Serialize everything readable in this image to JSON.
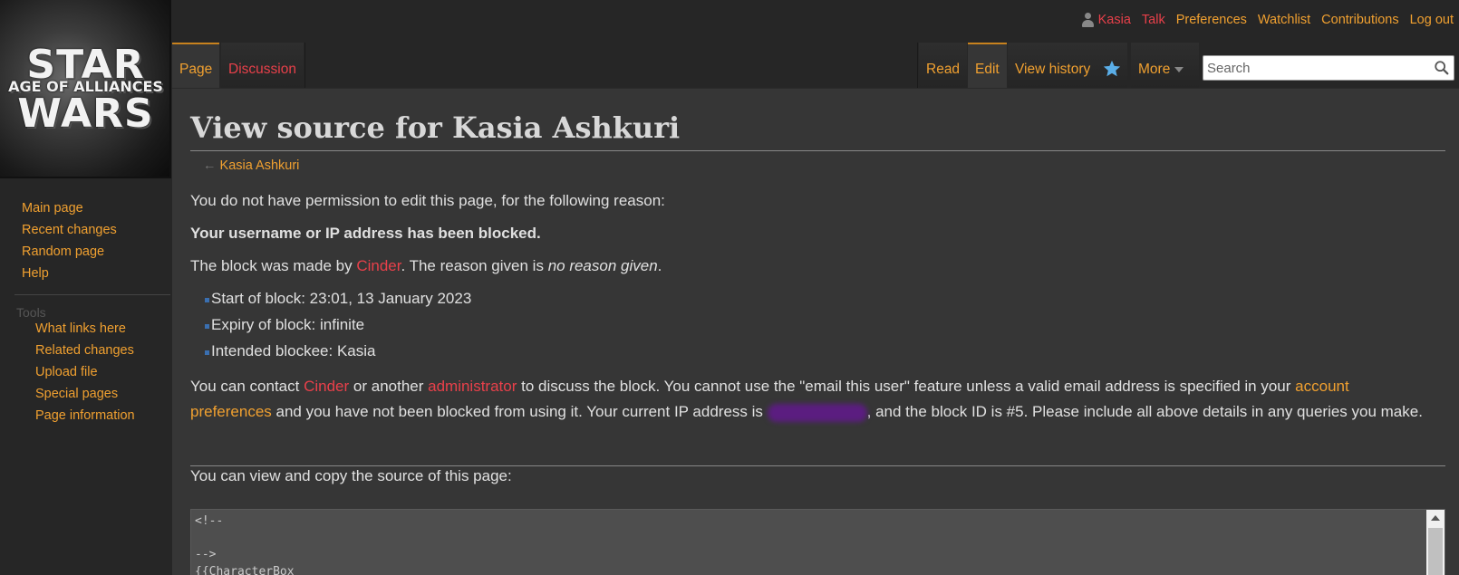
{
  "logo": {
    "line1": "STAR",
    "line2": "AGE OF ALLIANCES",
    "line3": "WARS"
  },
  "personal": {
    "username": "Kasia",
    "talk": "Talk",
    "preferences": "Preferences",
    "watchlist": "Watchlist",
    "contributions": "Contributions",
    "logout": "Log out"
  },
  "tabs": {
    "page": "Page",
    "discussion": "Discussion",
    "read": "Read",
    "edit": "Edit",
    "view_history": "View history",
    "more": "More"
  },
  "search": {
    "placeholder": "Search"
  },
  "sidebar": {
    "navigation": [
      "Main page",
      "Recent changes",
      "Random page",
      "Help"
    ],
    "tools_heading": "Tools",
    "tools": [
      "What links here",
      "Related changes",
      "Upload file",
      "Special pages",
      "Page information"
    ]
  },
  "content": {
    "title": "View source for Kasia Ashkuri",
    "backlink_arrow": "←",
    "backlink": "Kasia Ashkuri",
    "permission": "You do not have permission to edit this page, for the following reason:",
    "blocked": "Your username or IP address has been blocked.",
    "block_by_pre": "The block was made by ",
    "block_by_user": "Cinder",
    "block_by_mid": ". The reason given is ",
    "block_reason": "no reason given",
    "block_by_end": ".",
    "details": [
      "Start of block: 23:01, 13 January 2023",
      "Expiry of block: infinite",
      "Intended blockee: Kasia"
    ],
    "contact_1": "You can contact ",
    "contact_user": "Cinder",
    "contact_2": " or another ",
    "contact_admin": "administrator",
    "contact_3": " to discuss the block. You cannot use the \"email this user\" feature unless a valid email address is specified in your ",
    "contact_prefs": "account preferences",
    "contact_4": " and you have not been blocked from using it. Your current IP address is ",
    "contact_5": ", and the block ID is #5. Please include all above details in any queries you make.",
    "source_intro": "You can view and copy the source of this page:",
    "source_lines": "<!--\n\n-->\n{{CharacterBox"
  },
  "colors": {
    "link": "#f0a030",
    "redlink": "#e8404a",
    "background": "#262626",
    "content_bg": "#363636"
  }
}
